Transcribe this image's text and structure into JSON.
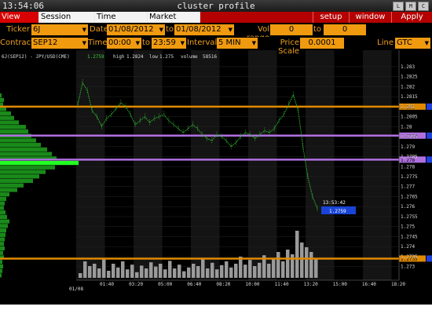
{
  "window": {
    "clock": "13:54:06",
    "title": "cluster profile",
    "controls": [
      "L",
      "M",
      "C"
    ]
  },
  "menubar": {
    "left": [
      "View DOM",
      "Session Hours",
      "Time Interval",
      "Market Watch"
    ],
    "right": [
      "setup",
      "window",
      "Apply"
    ]
  },
  "controls": {
    "ticker_label": "Ticker",
    "ticker_value": "6J",
    "date_label": "Date",
    "date_from": "01/08/2012",
    "date_to_label": "to",
    "date_to": "01/08/2012",
    "vol_range_label": "Vol range",
    "vol_from": "0",
    "vol_to_label": "to",
    "vol_to": "0",
    "contract_label": "Contract",
    "contract_value": "SEP12",
    "time_label": "Time",
    "time_from": "00:00",
    "time_to_label": "to",
    "time_to": "23:59",
    "interval_label": "Interval",
    "interval_value": "5 MIN",
    "price_scale_label": "Price Scale",
    "price_scale_value": "0.0001",
    "line_label": "Line",
    "line_value": "GTC"
  },
  "chart_info": {
    "symbol": "6J(SEP12) - JPY/USD(CME)",
    "last": "1.2759",
    "high_label": "high",
    "high": "1.2824",
    "low_label": "low",
    "low": "1.275",
    "volume_label": "volume",
    "volume": "58516",
    "crosshair_time": "13:53:42",
    "crosshair_price": "1.2759",
    "date_label": "01/08"
  },
  "chart_data": {
    "type": "line",
    "y_ticks": [
      "1.283",
      "1.2825",
      "1.282",
      "1.2815",
      "1.281",
      "1.2805",
      "1.28",
      "1.2795",
      "1.279",
      "1.2785",
      "1.278",
      "1.2775",
      "1.277",
      "1.2765",
      "1.276",
      "1.2755",
      "1.275",
      "1.2745",
      "1.274",
      "1.2735",
      "1.273"
    ],
    "x_ticks": [
      "01:40",
      "03:20",
      "05:00",
      "06:40",
      "08:20",
      "10:00",
      "11:40",
      "13:20",
      "15:00",
      "16:40",
      "18:20"
    ],
    "ylim": [
      1.27275,
      1.28335
    ],
    "line_levels": [
      {
        "price": 1.281,
        "label": "1.281",
        "color": "#e08a00"
      },
      {
        "price": 1.27955,
        "label": "1.2796",
        "color": "#b070e0"
      },
      {
        "price": 1.27835,
        "label": "1.278",
        "color": "#b070e0"
      },
      {
        "price": 1.2734,
        "label": "1.2735",
        "color": "#e08a00"
      }
    ],
    "price_series": [
      1.2811,
      1.2822,
      1.2818,
      1.2808,
      1.2805,
      1.28,
      1.2804,
      1.2806,
      1.2809,
      1.2812,
      1.281,
      1.2806,
      1.2801,
      1.2803,
      1.2805,
      1.2802,
      1.2804,
      1.2805,
      1.2806,
      1.2803,
      1.2801,
      1.2799,
      1.2797,
      1.2799,
      1.2801,
      1.2799,
      1.2796,
      1.2794,
      1.2793,
      1.2796,
      1.2795,
      1.2793,
      1.279,
      1.2792,
      1.2795,
      1.2797,
      1.2796,
      1.2794,
      1.2796,
      1.2798,
      1.2797,
      1.2799,
      1.2803,
      1.2806,
      1.2811,
      1.2816,
      1.2808,
      1.279,
      1.2775,
      1.2765,
      1.2759
    ],
    "volume_profile": [
      0.02,
      0.05,
      0.04,
      0.08,
      0.14,
      0.18,
      0.24,
      0.33,
      0.36,
      0.4,
      0.46,
      0.52,
      0.6,
      0.66,
      0.72,
      1.0,
      0.7,
      0.58,
      0.5,
      0.42,
      0.3,
      0.22,
      0.12,
      0.08,
      0.06,
      0.05,
      0.07,
      0.09,
      0.12,
      0.1,
      0.08,
      0.07,
      0.06,
      0.05,
      0.06,
      0.04,
      0.05,
      0.03,
      0.04,
      0.03,
      0.02
    ],
    "volume_bars": [
      0.1,
      0.35,
      0.25,
      0.3,
      0.2,
      0.4,
      0.15,
      0.3,
      0.22,
      0.35,
      0.18,
      0.28,
      0.12,
      0.26,
      0.2,
      0.33,
      0.24,
      0.3,
      0.18,
      0.36,
      0.2,
      0.28,
      0.14,
      0.22,
      0.3,
      0.25,
      0.4,
      0.2,
      0.32,
      0.18,
      0.27,
      0.35,
      0.22,
      0.3,
      0.45,
      0.28,
      0.38,
      0.25,
      0.32,
      0.48,
      0.3,
      0.42,
      0.55,
      0.35,
      0.6,
      0.5,
      1.0,
      0.75,
      0.65,
      0.55,
      0.4
    ],
    "grid": true
  }
}
